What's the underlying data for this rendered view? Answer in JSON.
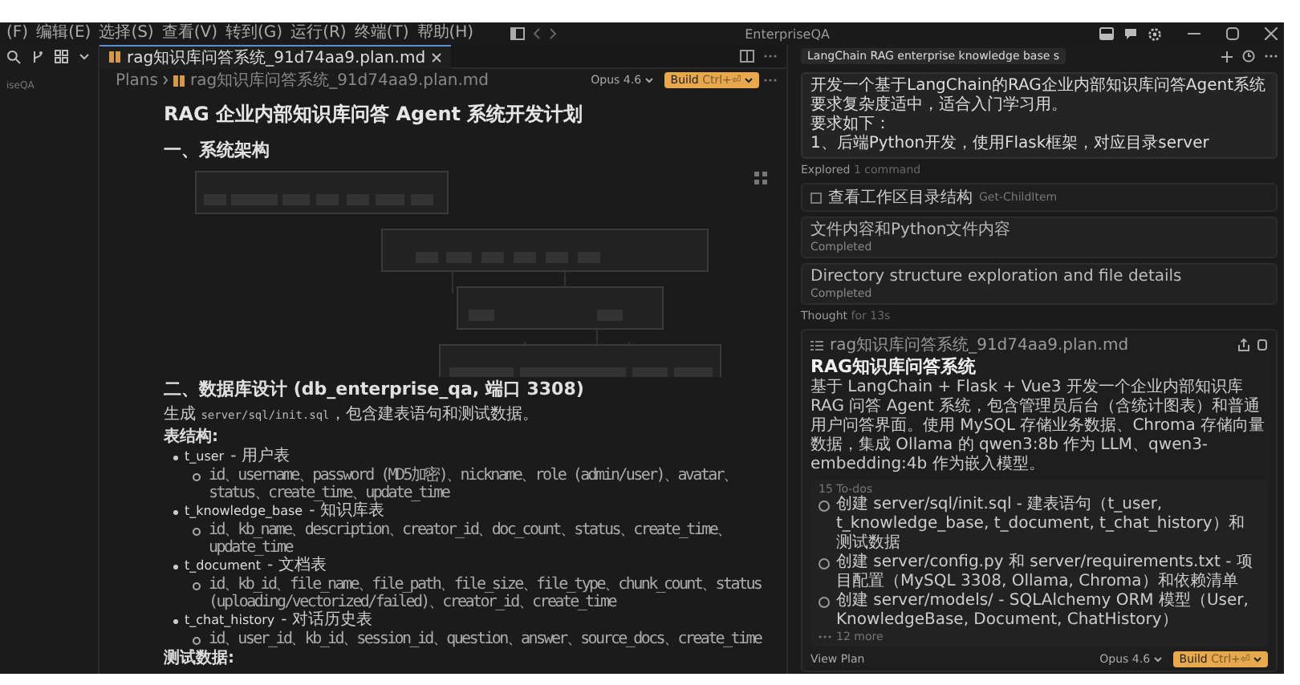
{
  "window": {
    "title": "EnterpriseQA"
  },
  "menu": [
    "(F)",
    "编辑(E)",
    "选择(S)",
    "查看(V)",
    "转到(G)",
    "运行(R)",
    "终端(T)",
    "帮助(H)"
  ],
  "sidebar": {
    "label": "iseQA"
  },
  "editor": {
    "tab": {
      "label": "rag知识库问答系统_91d74aa9.plan.md",
      "selected": true
    },
    "breadcrumb": [
      "Plans",
      "rag知识库问答系统_91d74aa9.plan.md"
    ],
    "model": "Opus 4.6",
    "build": {
      "label": "Build",
      "shortcut": "Ctrl+⏎"
    },
    "title": "RAG 企业内部知识库问答 Agent 系统开发计划",
    "sections": [
      {
        "heading": "一、系统架构"
      },
      {
        "heading": "二、数据库设计 (db_enterprise_qa, 端口 3308)"
      }
    ],
    "intro": [
      {
        "kind": "text",
        "text": "生成 "
      },
      {
        "kind": "code",
        "text": "server/sql/init.sql"
      },
      {
        "kind": "text",
        "text": "，包含建表语句和测试数据。"
      }
    ],
    "structure_label": "表结构:",
    "tables": [
      {
        "name": "t_user",
        "desc": "- 用户表",
        "fields": "id、username、password (MD5加密)、nickname、role (admin/user)、avatar、status、create_time、update_time"
      },
      {
        "name": "t_knowledge_base",
        "desc": "- 知识库表",
        "fields": "id、kb_name、description、creator_id、doc_count、status、create_time、update_time"
      },
      {
        "name": "t_document",
        "desc": "- 文档表",
        "fields": "id、kb_id、file_name、file_path、file_size、file_type、chunk_count、status (uploading/vectorized/failed)、creator_id、create_time"
      },
      {
        "name": "t_chat_history",
        "desc": "- 对话历史表",
        "fields": "id、user_id、kb_id、session_id、question、answer、source_docs、create_time"
      }
    ],
    "test_label": "测试数据:"
  },
  "chat": {
    "title": "LangChain RAG enterprise knowledge base s",
    "message": [
      "开发一个基于LangChain的RAG企业内部知识库问答Agent系统要求复杂度适中，适合入门学习用。",
      "要求如下：",
      "1、后端Python开发，使用Flask框架，对应目录server"
    ],
    "explored": {
      "label": "Explored",
      "detail": "1 command"
    },
    "command": {
      "text": "查看工作区目录结构",
      "code": "Get-ChildItem"
    },
    "tasks": [
      {
        "title": "文件内容和Python文件内容",
        "status": "Completed"
      },
      {
        "title": "Directory structure exploration and file details",
        "status": "Completed"
      }
    ],
    "thought": {
      "label": "Thought",
      "detail": "for 13s"
    },
    "plan": {
      "file": "rag知识库问答系统_91d74aa9.plan.md",
      "title": "RAG知识库问答系统",
      "description": "基于 LangChain + Flask + Vue3 开发一个企业内部知识库 RAG 问答 Agent 系统，包含管理员后台（含统计图表）和普通用户问答界面。使用 MySQL 存储业务数据、Chroma 存储向量数据，集成 Ollama 的 qwen3:8b 作为 LLM、qwen3-embedding:4b 作为嵌入模型。",
      "todo_count": "15 To-dos",
      "todos": [
        {
          "text": "创建 server/sql/init.sql - 建表语句（t_user, t_knowledge_base, t_document, t_chat_history）和测试数据",
          "checked": false
        },
        {
          "text": "创建 server/config.py 和 server/requirements.txt - 项目配置（MySQL 3308, Ollama, Chroma）和依赖清单",
          "checked": false
        },
        {
          "text": "创建 server/models/ - SQLAlchemy ORM 模型（User, KnowledgeBase, Document, ChatHistory）",
          "checked": false
        }
      ],
      "more": "12 more",
      "view": "View Plan",
      "model": "Opus 4.6",
      "build": {
        "label": "Build",
        "shortcut": "Ctrl+⏎"
      }
    }
  }
}
